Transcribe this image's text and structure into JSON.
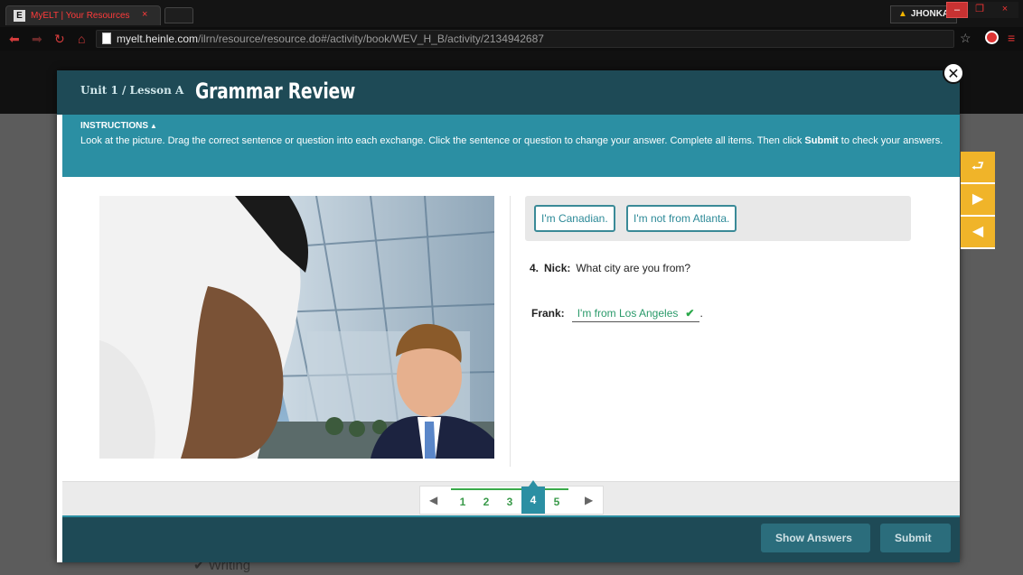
{
  "browser": {
    "tab_favicon": "E",
    "tab_title": "MyELT | Your Resources",
    "tab_close": "×",
    "user_badge": "JHONKA",
    "url_host": "myelt.heinle.com",
    "url_path": "/ilrn/resource/resource.do#/activity/book/WEV_H_B/activity/2134942687"
  },
  "modal": {
    "unit_label": "Unit 1 / Lesson A",
    "title": "Grammar Review",
    "instructions_heading": "INSTRUCTIONS",
    "instructions_text_before": "Look at the picture. Drag the correct sentence or question into each exchange. Click the sentence or question to change your answer. Complete all items. Then click ",
    "instructions_submit_word": "Submit",
    "instructions_text_after": " to check your answers.",
    "word_bank": [
      "I'm Canadian.",
      "I'm not from Atlanta."
    ],
    "question": {
      "number": "4.",
      "speaker": "Nick:",
      "text": "What city are you from?"
    },
    "answer": {
      "speaker": "Frank:",
      "text": "I'm from Los Angeles",
      "after": "."
    },
    "pages": [
      "1",
      "2",
      "3",
      "4",
      "5"
    ],
    "current_page": "4",
    "show_answers_label": "Show Answers",
    "submit_label": "Submit"
  },
  "background": {
    "link_text": "Writing"
  },
  "colors": {
    "header": "#1e4a56",
    "instructions": "#2b8fa3",
    "correct": "#2aa84a",
    "tools": "#f0b429"
  },
  "icons": [
    "warning-icon",
    "back-icon",
    "forward-icon",
    "reload-icon",
    "home-icon",
    "star-icon",
    "close-icon",
    "check-icon",
    "chevron-left-icon",
    "chevron-right-icon",
    "return-icon",
    "play-icon"
  ]
}
